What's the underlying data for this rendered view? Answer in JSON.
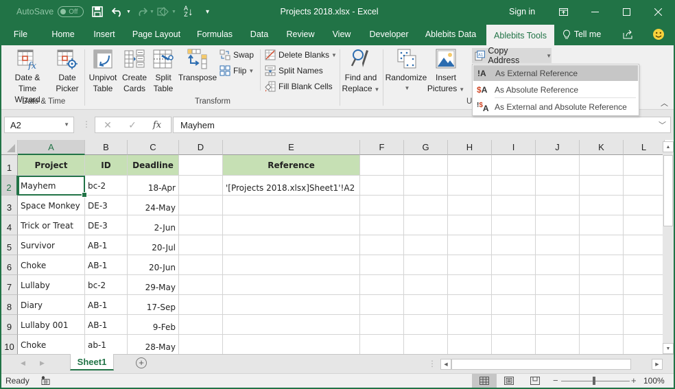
{
  "titlebar": {
    "autosave_label": "AutoSave",
    "autosave_state": "Off",
    "window_title": "Projects 2018.xlsx  -  Excel",
    "sign_in": "Sign in"
  },
  "tabs": [
    {
      "label": "File"
    },
    {
      "label": "Home"
    },
    {
      "label": "Insert"
    },
    {
      "label": "Page Layout"
    },
    {
      "label": "Formulas"
    },
    {
      "label": "Data"
    },
    {
      "label": "Review"
    },
    {
      "label": "View"
    },
    {
      "label": "Developer"
    },
    {
      "label": "Ablebits Data"
    },
    {
      "label": "Ablebits Tools",
      "active": true
    },
    {
      "label": "Tell me"
    }
  ],
  "ribbon": {
    "date_time_wizard": [
      "Date &",
      "Time Wizard"
    ],
    "date_picker": [
      "Date",
      "Picker"
    ],
    "group_date_time": "Date & Time",
    "unpivot_table": [
      "Unpivot",
      "Table"
    ],
    "create_cards": [
      "Create",
      "Cards"
    ],
    "split_table": [
      "Split",
      "Table"
    ],
    "transpose": "Transpose",
    "swap": "Swap",
    "flip": "Flip",
    "group_transform": "Transform",
    "delete_blanks": "Delete Blanks",
    "split_names": "Split Names",
    "fill_blank_cells": "Fill Blank Cells",
    "find_replace": [
      "Find and",
      "Replace"
    ],
    "randomize": "Randomize",
    "insert_pictures": [
      "Insert",
      "Pictures"
    ],
    "group_u_partial": "U",
    "copy_address": "Copy Address"
  },
  "copy_address_menu": [
    {
      "icon": "!A",
      "label": "As External Reference",
      "highlighted": true
    },
    {
      "icon": "$A",
      "label": "As Absolute Reference"
    },
    {
      "icon": "!$A",
      "label": "As External and Absolute Reference"
    }
  ],
  "formula_bar": {
    "name_box": "A2",
    "fx": "fx",
    "formula": "Mayhem"
  },
  "sheet": {
    "columns": [
      "A",
      "B",
      "C",
      "D",
      "E",
      "F",
      "G",
      "H",
      "I",
      "J",
      "K",
      "L"
    ],
    "selected_column": "A",
    "selected_row": 2,
    "header_row": [
      "Project",
      "ID",
      "Deadline",
      "",
      "Reference"
    ],
    "rows": [
      {
        "num": "2",
        "project": "Mayhem",
        "id": "bc-2",
        "deadline": "18-Apr",
        "reference": "'[Projects 2018.xlsx]Sheet1'!A2"
      },
      {
        "num": "3",
        "project": "Space Monkey",
        "id": "DE-3",
        "deadline": "24-May",
        "reference": ""
      },
      {
        "num": "4",
        "project": "Trick or Treat",
        "id": "DE-3",
        "deadline": "2-Jun",
        "reference": ""
      },
      {
        "num": "5",
        "project": "Survivor",
        "id": "AB-1",
        "deadline": "20-Jul",
        "reference": ""
      },
      {
        "num": "6",
        "project": "Choke",
        "id": "AB-1",
        "deadline": "20-Jun",
        "reference": ""
      },
      {
        "num": "7",
        "project": "Lullaby",
        "id": "bc-2",
        "deadline": "29-May",
        "reference": ""
      },
      {
        "num": "8",
        "project": "Diary",
        "id": "AB-1",
        "deadline": "17-Sep",
        "reference": ""
      },
      {
        "num": "9",
        "project": "Lullaby 001",
        "id": "AB-1",
        "deadline": "9-Feb",
        "reference": ""
      },
      {
        "num": "10",
        "project": "Choke",
        "id": "ab-1",
        "deadline": "28-May",
        "reference": ""
      }
    ]
  },
  "sheet_tabs": {
    "active": "Sheet1"
  },
  "statusbar": {
    "status": "Ready",
    "zoom": "100%"
  },
  "colors": {
    "brand": "#217346",
    "header_fill": "#c6e0b4"
  }
}
